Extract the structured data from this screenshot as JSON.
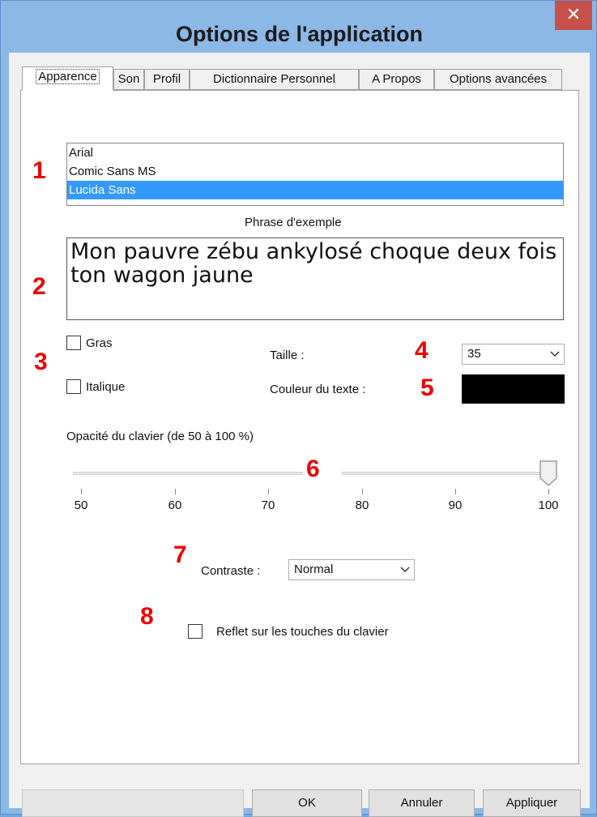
{
  "window": {
    "title": "Options de l'application",
    "close_glyph": "✕"
  },
  "tabs": [
    {
      "label": "Apparence",
      "active": true
    },
    {
      "label": "Son"
    },
    {
      "label": "Profil"
    },
    {
      "label": "Dictionnaire Personnel"
    },
    {
      "label": "A Propos"
    },
    {
      "label": "Options avancées"
    }
  ],
  "markers": [
    "1",
    "2",
    "3",
    "4",
    "5",
    "6",
    "7",
    "8"
  ],
  "font_list": {
    "items": [
      "Arial",
      "Comic Sans MS",
      "Lucida Sans"
    ],
    "selected": "Lucida Sans"
  },
  "sample": {
    "label": "Phrase d'exemple",
    "text": "Mon pauvre zébu ankylosé choque deux fois ton wagon jaune"
  },
  "style": {
    "bold_label": "Gras",
    "italic_label": "Italique",
    "bold_checked": false,
    "italic_checked": false
  },
  "size": {
    "label": "Taille :",
    "value": "35"
  },
  "text_color": {
    "label": "Couleur du texte :",
    "value": "#000000"
  },
  "opacity": {
    "label": "Opacité du clavier (de 50 à 100 %)",
    "ticks": [
      "50",
      "60",
      "70",
      "80",
      "90",
      "100"
    ],
    "value": 100
  },
  "contrast": {
    "label": "Contraste :",
    "value": "Normal"
  },
  "reflection": {
    "label": "Reflet sur les touches du clavier",
    "checked": false
  },
  "buttons": {
    "ok": "OK",
    "cancel": "Annuler",
    "apply": "Appliquer"
  },
  "colors": {
    "accent": "#3399ff",
    "marker": "#ee0000",
    "close": "#c7504a",
    "title_bar": "#8cb8e6"
  },
  "icons": {
    "dropdown": "chevron-down-icon",
    "close": "close-icon",
    "slider_thumb": "slider-thumb-icon"
  }
}
